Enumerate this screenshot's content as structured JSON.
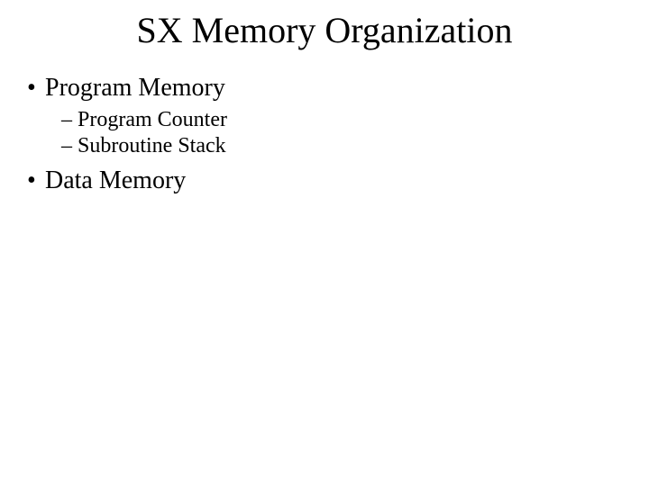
{
  "title": "SX Memory Organization",
  "markers": {
    "bullet": "•",
    "dash": "–"
  },
  "items": {
    "programMemory": "Program Memory",
    "programCounter": "Program Counter",
    "subroutineStack": "Subroutine Stack",
    "dataMemory": "Data Memory"
  }
}
